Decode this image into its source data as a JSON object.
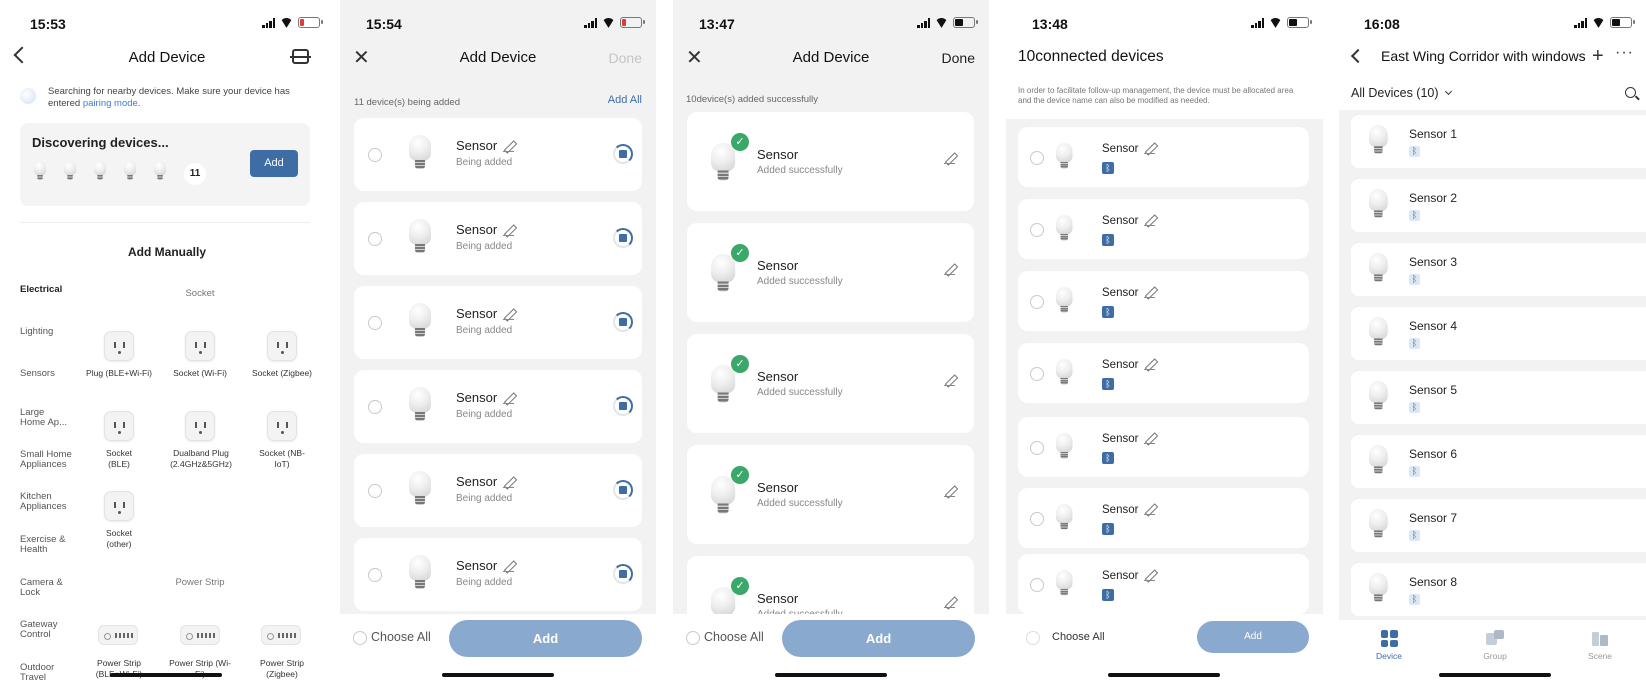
{
  "s1": {
    "time": "15:53",
    "title": "Add Device",
    "search_text": "Searching for nearby devices. Make sure your device has entered ",
    "pairing_link": "pairing mode",
    "discover_title": "Discovering devices...",
    "discover_count": "11",
    "add_label": "Add",
    "manual_title": "Add Manually",
    "categories": [
      "Electrical",
      "Lighting",
      "Sensors",
      "Large Home Ap...",
      "Small Home Appliances",
      "Kitchen Appliances",
      "Exercise & Health",
      "Camera & Lock",
      "Gateway Control",
      "Outdoor Travel"
    ],
    "section_socket": "Socket",
    "section_strip": "Power Strip",
    "items": [
      "Plug (BLE+Wi-Fi)",
      "Socket (Wi-Fi)",
      "Socket (Zigbee)",
      "Socket (BLE)",
      "Dualband Plug (2.4GHz&5GHz)",
      "Socket (NB-IoT)",
      "Socket (other)"
    ],
    "strips": [
      "Power Strip (BLE+Wi-Fi)",
      "Power Strip (Wi-Fi)",
      "Power Strip (Zigbee)"
    ],
    "battery_color": "#e03b3b"
  },
  "s2": {
    "time": "15:54",
    "title": "Add Device",
    "done": "Done",
    "status": "11 device(s) being added",
    "add_all": "Add All",
    "device_name": "Sensor",
    "device_status": "Being added",
    "choose_all": "Choose All",
    "add": "Add",
    "battery_color": "#e03b3b"
  },
  "s3": {
    "time": "13:47",
    "title": "Add Device",
    "done": "Done",
    "status": "10device(s) added successfully",
    "device_name": "Sensor",
    "device_status": "Added successfully",
    "choose_all": "Choose All",
    "add": "Add",
    "battery_color": "#111111"
  },
  "s4": {
    "time": "13:48",
    "title_count": "10",
    "title_text": "connected devices",
    "note": "In order to facilitate follow-up management, the device must be allocated area and the device name can also be modified as needed.",
    "device_name": "Sensor",
    "choose_all": "Choose All",
    "add": "Add",
    "battery_color": "#111111"
  },
  "s5": {
    "time": "16:08",
    "title": "East Wing Corridor with windows",
    "filter": "All Devices (10)",
    "devices": [
      "Sensor 1",
      "Sensor 2",
      "Sensor 3",
      "Sensor 4",
      "Sensor 5",
      "Sensor 6",
      "Sensor 7",
      "Sensor 8"
    ],
    "tabs": [
      "Device",
      "Group",
      "Scene"
    ],
    "battery_color": "#111111"
  },
  "colors": {
    "accent": "#3e6da6",
    "button_disabled": "#8aa9ce",
    "success": "#3aa868",
    "link": "#3e7bd6"
  },
  "icons": [
    "back-icon",
    "scan-icon",
    "close-icon",
    "pencil-icon",
    "bluetooth-icon",
    "search-icon",
    "plus-icon",
    "more-icon",
    "chevron-down-icon",
    "check-icon",
    "spinner-icon"
  ]
}
